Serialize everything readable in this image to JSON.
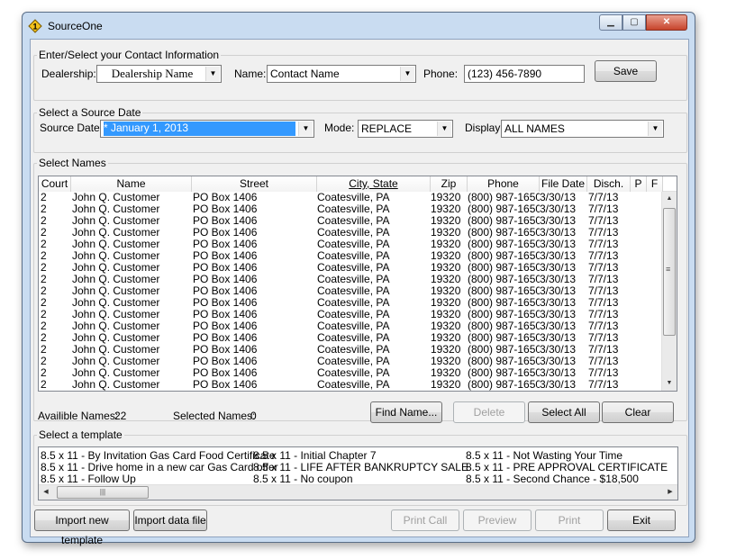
{
  "window": {
    "title": "SourceOne"
  },
  "contact": {
    "legend": "Enter/Select your Contact Information",
    "dealership_label": "Dealership:",
    "dealership_value": "Dealership Name",
    "name_label": "Name:",
    "name_value": "Contact Name",
    "phone_label": "Phone:",
    "phone_value": "(123) 456-7890",
    "save_label": "Save"
  },
  "source": {
    "legend": "Select a Source Date",
    "date_label": "Source Date:",
    "date_value": "* January 1, 2013",
    "mode_label": "Mode:",
    "mode_value": "REPLACE",
    "display_label": "Display:",
    "display_value": "ALL NAMES"
  },
  "names": {
    "legend": "Select Names",
    "columns": [
      "Court",
      "Name",
      "Street",
      "City, State",
      "Zip",
      "Phone",
      "File Date",
      "Disch.",
      "P",
      "F"
    ],
    "rows": [
      [
        "2",
        "John Q. Customer",
        "PO Box 1406",
        "Coatesville, PA",
        "19320",
        "(800) 987-1650",
        "3/30/13",
        "7/7/13"
      ],
      [
        "2",
        "John Q. Customer",
        "PO Box 1406",
        "Coatesville, PA",
        "19320",
        "(800) 987-1650",
        "3/30/13",
        "7/7/13"
      ],
      [
        "2",
        "John Q. Customer",
        "PO Box 1406",
        "Coatesville, PA",
        "19320",
        "(800) 987-1650",
        "3/30/13",
        "7/7/13"
      ],
      [
        "2",
        "John Q. Customer",
        "PO Box 1406",
        "Coatesville, PA",
        "19320",
        "(800) 987-1650",
        "3/30/13",
        "7/7/13"
      ],
      [
        "2",
        "John Q. Customer",
        "PO Box 1406",
        "Coatesville, PA",
        "19320",
        "(800) 987-1650",
        "3/30/13",
        "7/7/13"
      ],
      [
        "2",
        "John Q. Customer",
        "PO Box 1406",
        "Coatesville, PA",
        "19320",
        "(800) 987-1650",
        "3/30/13",
        "7/7/13"
      ],
      [
        "2",
        "John Q. Customer",
        "PO Box 1406",
        "Coatesville, PA",
        "19320",
        "(800) 987-1650",
        "3/30/13",
        "7/7/13"
      ],
      [
        "2",
        "John Q. Customer",
        "PO Box 1406",
        "Coatesville, PA",
        "19320",
        "(800) 987-1650",
        "3/30/13",
        "7/7/13"
      ],
      [
        "2",
        "John Q. Customer",
        "PO Box 1406",
        "Coatesville, PA",
        "19320",
        "(800) 987-1650",
        "3/30/13",
        "7/7/13"
      ],
      [
        "2",
        "John Q. Customer",
        "PO Box 1406",
        "Coatesville, PA",
        "19320",
        "(800) 987-1650",
        "3/30/13",
        "7/7/13"
      ],
      [
        "2",
        "John Q. Customer",
        "PO Box 1406",
        "Coatesville, PA",
        "19320",
        "(800) 987-1650",
        "3/30/13",
        "7/7/13"
      ],
      [
        "2",
        "John Q. Customer",
        "PO Box 1406",
        "Coatesville, PA",
        "19320",
        "(800) 987-1650",
        "3/30/13",
        "7/7/13"
      ],
      [
        "2",
        "John Q. Customer",
        "PO Box 1406",
        "Coatesville, PA",
        "19320",
        "(800) 987-1650",
        "3/30/13",
        "7/7/13"
      ],
      [
        "2",
        "John Q. Customer",
        "PO Box 1406",
        "Coatesville, PA",
        "19320",
        "(800) 987-1650",
        "3/30/13",
        "7/7/13"
      ],
      [
        "2",
        "John Q. Customer",
        "PO Box 1406",
        "Coatesville, PA",
        "19320",
        "(800) 987-1650",
        "3/30/13",
        "7/7/13"
      ],
      [
        "2",
        "John Q. Customer",
        "PO Box 1406",
        "Coatesville, PA",
        "19320",
        "(800) 987-1650",
        "3/30/13",
        "7/7/13"
      ],
      [
        "2",
        "John Q. Customer",
        "PO Box 1406",
        "Coatesville, PA",
        "19320",
        "(800) 987-1650",
        "3/30/13",
        "7/7/13"
      ]
    ],
    "available_label": "Availible Names:",
    "available_count": "22",
    "selected_label": "Selected Names:",
    "selected_count": "0",
    "find_label": "Find Name...",
    "delete_label": "Delete",
    "select_all_label": "Select All",
    "clear_label": "Clear"
  },
  "templates": {
    "legend": "Select a template",
    "items": [
      "8.5 x 11 - By Invitation Gas Card Food Certificate",
      "8.5 x 11 - Drive home in a new car Gas Card offer",
      "8.5 x 11 - Follow Up",
      "8.5 x 11 - Initial Chapter 7",
      "8.5 x 11 - LIFE AFTER BANKRUPTCY SALE",
      "8.5 x 11 - No coupon",
      "8.5 x 11 - Not Wasting Your Time",
      "8.5 x 11 - PRE APPROVAL CERTIFICATE",
      "8.5 x 11 - Second Chance - $18,500"
    ]
  },
  "footer": {
    "import_template_label": "Import new template",
    "import_data_label": "Import data file",
    "print_call_label": "Print Call",
    "preview_label": "Preview",
    "print_label": "Print",
    "exit_label": "Exit"
  },
  "icons": {
    "app": "app-icon",
    "minimize": "minimize-icon",
    "maximize": "maximize-icon",
    "close": "close-icon",
    "dropdown": "chevron-down-icon"
  }
}
